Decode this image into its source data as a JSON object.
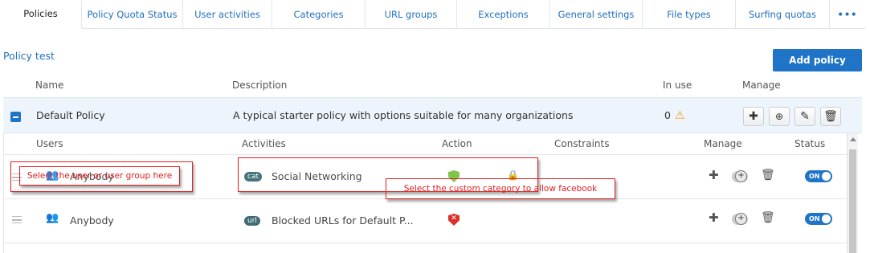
{
  "tabs": [
    {
      "label": "Policies"
    },
    {
      "label": "Policy Quota Status"
    },
    {
      "label": "User activities"
    },
    {
      "label": "Categories"
    },
    {
      "label": "URL groups"
    },
    {
      "label": "Exceptions"
    },
    {
      "label": "General settings"
    },
    {
      "label": "File types"
    },
    {
      "label": "Surfing quotas"
    },
    {
      "label": "•••"
    }
  ],
  "section_title": "Policy test",
  "add_policy_label": "Add policy",
  "table_headers": {
    "name": "Name",
    "description": "Description",
    "in_use": "In use",
    "manage": "Manage"
  },
  "policy": {
    "name": "Default Policy",
    "description": "A typical starter policy with options suitable for many organizations",
    "in_use": "0",
    "warning_icon": "warning-icon"
  },
  "rule_headers": {
    "users": "Users",
    "activities": "Activities",
    "action": "Action",
    "constraints": "Constraints",
    "manage": "Manage",
    "status": "Status"
  },
  "rules": [
    {
      "user": "Anybody",
      "activity_tag": "cat",
      "activity": "Social Networking",
      "action": "allow",
      "status": "ON"
    },
    {
      "user": "Anybody",
      "activity_tag": "url",
      "activity": "Blocked URLs for Default P...",
      "action": "block",
      "status": "ON"
    }
  ],
  "annotations": {
    "user_group": "Select the user or user group here",
    "custom_category": "Select the custom category to allow facebook"
  },
  "colors": {
    "accent": "#1f74c8",
    "annotation": "#e02020",
    "allow": "#7ac143",
    "block": "#d9322c"
  }
}
